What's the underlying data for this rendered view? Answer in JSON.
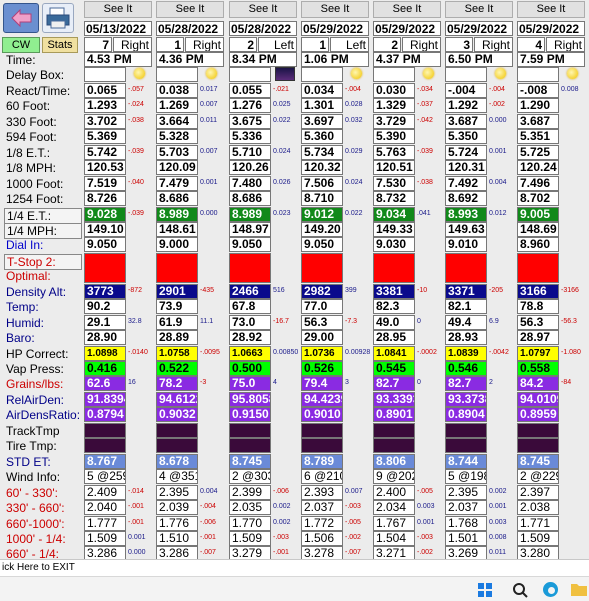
{
  "toolbar": {
    "cw_label": "CW",
    "stats_label": "Stats"
  },
  "columns": [
    {
      "see_label": "See It",
      "date": "05/13/2022",
      "run": "7",
      "lane": "Right",
      "time": "4.53 PM",
      "weather": "sun"
    },
    {
      "see_label": "See It",
      "date": "05/28/2022",
      "run": "1",
      "lane": "Right",
      "time": "4.36 PM",
      "weather": "sun"
    },
    {
      "see_label": "See It",
      "date": "05/28/2022",
      "run": "2",
      "lane": "Left",
      "time": "8.34 PM",
      "weather": "night"
    },
    {
      "see_label": "See It",
      "date": "05/29/2022",
      "run": "1",
      "lane": "Left",
      "time": "1.06 PM",
      "weather": "sun"
    },
    {
      "see_label": "See It",
      "date": "05/29/2022",
      "run": "2",
      "lane": "Right",
      "time": "4.37 PM",
      "weather": "sun"
    },
    {
      "see_label": "See It",
      "date": "05/29/2022",
      "run": "3",
      "lane": "Right",
      "time": "6.50 PM",
      "weather": "sun"
    },
    {
      "see_label": "See It",
      "date": "05/29/2022",
      "run": "4",
      "lane": "Right",
      "time": "7.59 PM",
      "weather": "sun"
    }
  ],
  "rows": [
    {
      "label": "Time:",
      "label_color": "#000000",
      "cell_bg": "#ffffff",
      "cell_color": "#000000",
      "values": [
        null,
        null,
        null,
        null,
        null,
        null,
        null
      ],
      "deltas": [
        null,
        null,
        null,
        null,
        null,
        null,
        null
      ],
      "special": "time"
    },
    {
      "label": "Delay Box:",
      "label_color": "#000000",
      "cell_bg": "#ffffff",
      "cell_color": "#000000",
      "values": [
        "",
        "",
        "",
        "",
        "",
        "",
        ""
      ],
      "deltas": [
        null,
        null,
        null,
        null,
        null,
        null,
        null
      ]
    },
    {
      "label": "React/Time:",
      "label_color": "#000000",
      "cell_bg": "#ffffff",
      "cell_color": "#000000",
      "values": [
        "0.065",
        "0.038",
        "0.055",
        "0.034",
        "0.030",
        "-.004",
        "-.008"
      ],
      "deltas": [
        "-.057",
        "0.017",
        "-.021",
        "-.004",
        "-.034",
        "-.004",
        "0.008"
      ]
    },
    {
      "label": "60 Foot:",
      "label_color": "#000000",
      "cell_bg": "#ffffff",
      "cell_color": "#000000",
      "values": [
        "1.293",
        "1.269",
        "1.276",
        "1.301",
        "1.329",
        "1.292",
        "1.290"
      ],
      "deltas": [
        "-.024",
        "0.007",
        "0.025",
        "0.028",
        "-.037",
        "-.002",
        null
      ]
    },
    {
      "label": "330 Foot:",
      "label_color": "#000000",
      "cell_bg": "#ffffff",
      "cell_color": "#000000",
      "values": [
        "3.702",
        "3.664",
        "3.675",
        "3.697",
        "3.729",
        "3.687",
        "3.687"
      ],
      "deltas": [
        "-.038",
        "0.011",
        "0.022",
        "0.032",
        "-.042",
        "0.000",
        null
      ]
    },
    {
      "label": "594 Foot:",
      "label_color": "#000000",
      "cell_bg": "#ffffff",
      "cell_color": "#000000",
      "values": [
        "5.369",
        "5.328",
        "5.336",
        "5.360",
        "5.390",
        "5.350",
        "5.351"
      ],
      "deltas": [
        null,
        null,
        null,
        null,
        null,
        null,
        null
      ]
    },
    {
      "label": "1/8 E.T.:",
      "label_color": "#000000",
      "cell_bg": "#ffffff",
      "cell_color": "#000000",
      "values": [
        "5.742",
        "5.703",
        "5.710",
        "5.734",
        "5.763",
        "5.724",
        "5.725"
      ],
      "deltas": [
        "-.039",
        "0.007",
        "0.024",
        "0.029",
        "-.039",
        "0.001",
        null
      ]
    },
    {
      "label": "1/8 MPH:",
      "label_color": "#000000",
      "cell_bg": "#ffffff",
      "cell_color": "#000000",
      "values": [
        "120.53",
        "120.09",
        "120.26",
        "120.32",
        "120.51",
        "120.31",
        "120.24"
      ],
      "deltas": [
        null,
        null,
        null,
        null,
        null,
        null,
        null
      ]
    },
    {
      "label": "1000 Foot:",
      "label_color": "#000000",
      "cell_bg": "#ffffff",
      "cell_color": "#000000",
      "values": [
        "7.519",
        "7.479",
        "7.480",
        "7.506",
        "7.530",
        "7.492",
        "7.496"
      ],
      "deltas": [
        "-.040",
        "0.001",
        "0.026",
        "0.024",
        "-.038",
        "0.004",
        null
      ]
    },
    {
      "label": "1254 Foot:",
      "label_color": "#000000",
      "cell_bg": "#ffffff",
      "cell_color": "#000000",
      "values": [
        "8.726",
        "8.686",
        "8.686",
        "8.710",
        "8.732",
        "8.692",
        "8.702"
      ],
      "deltas": [
        null,
        null,
        null,
        null,
        null,
        null,
        null
      ]
    },
    {
      "label": "1/4 E.T.:",
      "label_color": "#000000",
      "cell_bg": "#11891a",
      "cell_color": "#ffffff",
      "label_boxed": true,
      "values": [
        "9.028",
        "8.989",
        "8.989",
        "9.012",
        "9.034",
        "8.993",
        "9.005"
      ],
      "deltas": [
        "-.039",
        "0.000",
        "0.023",
        "0.022",
        ".041",
        "0.012",
        null
      ]
    },
    {
      "label": "1/4 MPH:",
      "label_color": "#000000",
      "cell_bg": "#ffffff",
      "cell_color": "#000000",
      "label_boxed": true,
      "values": [
        "149.10",
        "148.61",
        "148.97",
        "149.20",
        "149.33",
        "149.63",
        "148.69"
      ],
      "deltas": [
        null,
        null,
        null,
        null,
        null,
        null,
        null
      ]
    },
    {
      "label": "Dial In:",
      "label_color": "#0000cc",
      "cell_bg": "#ffffff",
      "cell_color": "#000000",
      "values": [
        "9.050",
        "9.000",
        "9.050",
        "9.050",
        "9.030",
        "9.010",
        "8.960"
      ],
      "deltas": [
        null,
        null,
        null,
        null,
        null,
        null,
        null
      ]
    },
    {
      "label": "T-Stop 2:",
      "label_color": "#cc0000",
      "cell_bg": "#ff0000",
      "cell_color": "#ffffff",
      "label_boxed": true,
      "values": [
        "",
        "",
        "",
        "",
        "",
        "",
        ""
      ],
      "deltas": [
        null,
        null,
        null,
        null,
        null,
        null,
        null
      ],
      "tall": true
    },
    {
      "label": "Optimal:",
      "label_color": "#cc0000",
      "cell_bg": "#ff0000",
      "cell_color": "#ffffff",
      "values": null,
      "deltas": null,
      "merged_above": true
    },
    {
      "label": "Density Alt:",
      "label_color": "#000088",
      "cell_bg": "#0a0a8c",
      "cell_color": "#ffffff",
      "values": [
        "3773",
        "2901",
        "2466",
        "2982",
        "3381",
        "3371",
        "3166"
      ],
      "deltas": [
        "-872",
        "-435",
        "516",
        "399",
        "-10",
        "-205",
        "-3166"
      ]
    },
    {
      "label": "Temp:",
      "label_color": "#000088",
      "cell_bg": "#ffffff",
      "cell_color": "#000000",
      "values": [
        "90.2",
        "73.9",
        "67.8",
        "77.0",
        "82.3",
        "82.1",
        "78.8"
      ],
      "deltas": [
        null,
        null,
        null,
        null,
        null,
        null,
        null
      ]
    },
    {
      "label": "Humid:",
      "label_color": "#000088",
      "cell_bg": "#ffffff",
      "cell_color": "#000000",
      "values": [
        "29.1",
        "61.9",
        "73.0",
        "56.3",
        "49.0",
        "49.4",
        "56.3"
      ],
      "deltas": [
        "32.8",
        "11.1",
        "-16.7",
        "-7.3",
        "0",
        "6.9",
        "-56.3"
      ]
    },
    {
      "label": "Baro:",
      "label_color": "#000088",
      "cell_bg": "#ffffff",
      "cell_color": "#000000",
      "values": [
        "28.90",
        "28.89",
        "28.92",
        "29.00",
        "28.95",
        "28.93",
        "28.97"
      ],
      "deltas": [
        null,
        null,
        null,
        null,
        null,
        null,
        null
      ]
    },
    {
      "label": "HP Correct:",
      "label_color": "#000000",
      "cell_bg": "#ffff00",
      "cell_color": "#000000",
      "values": [
        "1.0898",
        "1.0758",
        "1.0663",
        "1.0736",
        "1.0841",
        "1.0839",
        "1.0797"
      ],
      "deltas": [
        "-.0140",
        "-.0095",
        "0.00850",
        "0.00928",
        "-.0002",
        "-.0042",
        "-1.080"
      ],
      "small": true
    },
    {
      "label": "Vap Press:",
      "label_color": "#000000",
      "cell_bg": "#00ff00",
      "cell_color": "#000000",
      "values": [
        "0.416",
        "0.522",
        "0.500",
        "0.526",
        "0.545",
        "0.546",
        "0.558"
      ],
      "deltas": [
        null,
        null,
        null,
        null,
        null,
        null,
        null
      ]
    },
    {
      "label": "Grains/lbs:",
      "label_color": "#cc0000",
      "cell_bg": "#8a2be2",
      "cell_color": "#ffffff",
      "values": [
        "62.6",
        "78.2",
        "75.0",
        "79.4",
        "82.7",
        "82.7",
        "84.2"
      ],
      "deltas": [
        "16",
        "-3",
        "4",
        "3",
        "0",
        "2",
        "-84"
      ]
    },
    {
      "label": "RelAirDen:",
      "label_color": "#000088",
      "cell_bg": "#8a2be2",
      "cell_color": "#ffffff",
      "values": [
        "91.8394",
        "94.6122",
        "95.8058",
        "94.4239",
        "93.3393",
        "93.3738",
        "94.0109"
      ],
      "deltas": [
        null,
        null,
        null,
        null,
        null,
        null,
        null
      ]
    },
    {
      "label": "AirDensRatio:",
      "label_color": "#000088",
      "cell_bg": "#8a2be2",
      "cell_color": "#ffffff",
      "values": [
        "0.8794",
        "0.9032",
        "0.9150",
        "0.9010",
        "0.8901",
        "0.8904",
        "0.8959"
      ],
      "deltas": [
        null,
        null,
        null,
        null,
        null,
        null,
        null
      ]
    },
    {
      "label": "TrackTmp",
      "label_color": "#000000",
      "cell_bg": "#3a0a3a",
      "cell_color": "#ffffff",
      "values": [
        "",
        "",
        "",
        "",
        "",
        "",
        ""
      ],
      "deltas": [
        null,
        null,
        null,
        null,
        null,
        null,
        null
      ]
    },
    {
      "label": "Tire Tmp:",
      "label_color": "#000000",
      "cell_bg": "#3a0a3a",
      "cell_color": "#ffffff",
      "values": [
        "",
        "",
        "",
        "",
        "",
        "",
        ""
      ],
      "deltas": [
        null,
        null,
        null,
        null,
        null,
        null,
        null
      ]
    },
    {
      "label": "STD ET:",
      "label_color": "#000088",
      "cell_bg": "#6a8ad8",
      "cell_color": "#ffffff",
      "values": [
        "8.767",
        "8.678",
        "8.745",
        "8.789",
        "8.806",
        "8.744",
        "8.745"
      ],
      "deltas": [
        null,
        null,
        null,
        null,
        null,
        null,
        null
      ]
    },
    {
      "label": "Wind Info:",
      "label_color": "#000000",
      "cell_bg": "#ffffff",
      "cell_color": "#000000",
      "values": [
        "5 @259",
        "4 @351",
        "2 @303",
        "6 @210",
        "9 @202",
        "5 @198",
        "2 @229"
      ],
      "deltas": [
        null,
        null,
        null,
        null,
        null,
        null,
        null
      ],
      "plain": true
    },
    {
      "label": "60' - 330':",
      "label_color": "#cc0000",
      "cell_bg": "#ffffff",
      "cell_color": "#000000",
      "values": [
        "2.409",
        "2.395",
        "2.399",
        "2.393",
        "2.400",
        "2.395",
        "2.397"
      ],
      "deltas": [
        "-.014",
        "0.004",
        "-.006",
        "0.007",
        "-.005",
        "0.002",
        null
      ],
      "plain": true
    },
    {
      "label": "330' - 660':",
      "label_color": "#cc0000",
      "cell_bg": "#ffffff",
      "cell_color": "#000000",
      "values": [
        "2.040",
        "2.039",
        "2.035",
        "2.037",
        "2.034",
        "2.037",
        "2.038"
      ],
      "deltas": [
        "-.001",
        "-.004",
        "0.002",
        "-.003",
        "0.003",
        "0.001",
        null
      ],
      "plain": true
    },
    {
      "label": "660'-1000':",
      "label_color": "#cc0000",
      "cell_bg": "#ffffff",
      "cell_color": "#000000",
      "values": [
        "1.777",
        "1.776",
        "1.770",
        "1.772",
        "1.767",
        "1.768",
        "1.771"
      ],
      "deltas": [
        "-.001",
        "-.006",
        "0.002",
        "-.005",
        "0.001",
        "0.003",
        null
      ],
      "plain": true
    },
    {
      "label": "1000' - 1/4:",
      "label_color": "#cc0000",
      "cell_bg": "#ffffff",
      "cell_color": "#000000",
      "values": [
        "1.509",
        "1.510",
        "1.509",
        "1.506",
        "1.504",
        "1.501",
        "1.509"
      ],
      "deltas": [
        "0.001",
        "-.001",
        "-.003",
        "-.002",
        "-.003",
        "0.008",
        null
      ],
      "plain": true
    },
    {
      "label": "660' - 1/4:",
      "label_color": "#cc0000",
      "cell_bg": "#ffffff",
      "cell_color": "#000000",
      "values": [
        "3.286",
        "3.286",
        "3.279",
        "3.278",
        "3.271",
        "3.269",
        "3.280"
      ],
      "deltas": [
        "0.000",
        "-.007",
        "-.001",
        "-.007",
        "-.002",
        "0.011",
        null
      ],
      "plain": true
    }
  ],
  "status": {
    "exit_text": "ick Here to EXIT"
  }
}
